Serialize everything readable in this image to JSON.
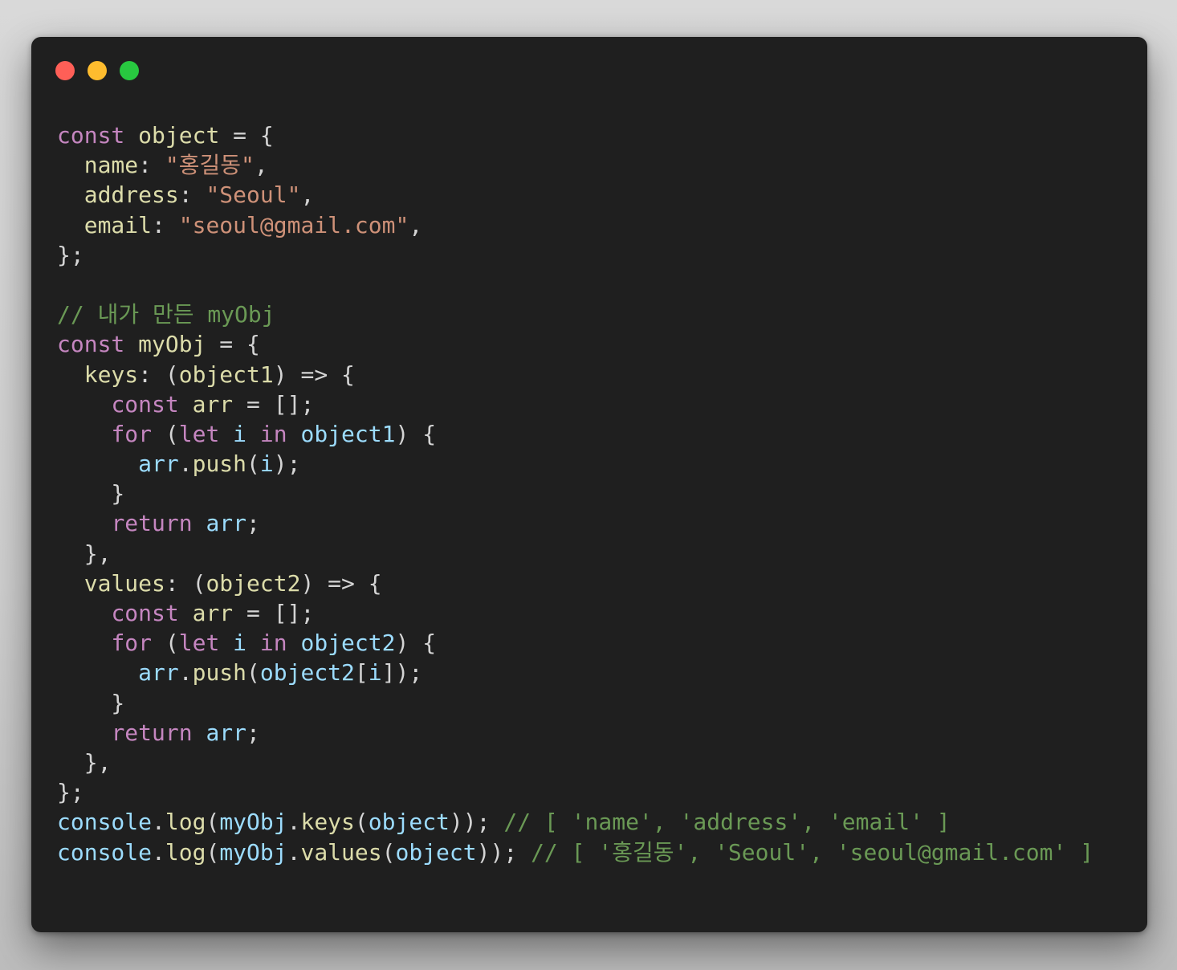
{
  "window": {
    "controls": {
      "close_color": "#ff5f57",
      "minimize_color": "#febc2e",
      "maximize_color": "#28c840"
    }
  },
  "code": {
    "language": "javascript",
    "lines": [
      [
        [
          "kw",
          "const "
        ],
        [
          "var",
          "object"
        ],
        [
          "pun",
          " = {"
        ]
      ],
      [
        [
          "pun",
          "  "
        ],
        [
          "var",
          "name"
        ],
        [
          "pun",
          ": "
        ],
        [
          "str",
          "\"홍길동\""
        ],
        [
          "pun",
          ","
        ]
      ],
      [
        [
          "pun",
          "  "
        ],
        [
          "var",
          "address"
        ],
        [
          "pun",
          ": "
        ],
        [
          "str",
          "\"Seoul\""
        ],
        [
          "pun",
          ","
        ]
      ],
      [
        [
          "pun",
          "  "
        ],
        [
          "var",
          "email"
        ],
        [
          "pun",
          ": "
        ],
        [
          "str",
          "\"seoul@gmail.com\""
        ],
        [
          "pun",
          ","
        ]
      ],
      [
        [
          "pun",
          "};"
        ]
      ],
      [],
      [
        [
          "cmt",
          "// 내가 만든 myObj"
        ]
      ],
      [
        [
          "kw",
          "const "
        ],
        [
          "var",
          "myObj"
        ],
        [
          "pun",
          " = {"
        ]
      ],
      [
        [
          "pun",
          "  "
        ],
        [
          "var",
          "keys"
        ],
        [
          "pun",
          ": ("
        ],
        [
          "var",
          "object1"
        ],
        [
          "pun",
          ") => {"
        ]
      ],
      [
        [
          "pun",
          "    "
        ],
        [
          "kw",
          "const "
        ],
        [
          "var",
          "arr"
        ],
        [
          "pun",
          " = [];"
        ]
      ],
      [
        [
          "pun",
          "    "
        ],
        [
          "kw",
          "for "
        ],
        [
          "pun",
          "("
        ],
        [
          "kw",
          "let "
        ],
        [
          "id",
          "i "
        ],
        [
          "kw",
          "in "
        ],
        [
          "id",
          "object1"
        ],
        [
          "pun",
          ") {"
        ]
      ],
      [
        [
          "pun",
          "      "
        ],
        [
          "id",
          "arr"
        ],
        [
          "pun",
          "."
        ],
        [
          "fn",
          "push"
        ],
        [
          "pun",
          "("
        ],
        [
          "id",
          "i"
        ],
        [
          "pun",
          ");"
        ]
      ],
      [
        [
          "pun",
          "    }"
        ]
      ],
      [
        [
          "pun",
          "    "
        ],
        [
          "kw",
          "return "
        ],
        [
          "id",
          "arr"
        ],
        [
          "pun",
          ";"
        ]
      ],
      [
        [
          "pun",
          "  },"
        ]
      ],
      [
        [
          "pun",
          "  "
        ],
        [
          "var",
          "values"
        ],
        [
          "pun",
          ": ("
        ],
        [
          "var",
          "object2"
        ],
        [
          "pun",
          ") => {"
        ]
      ],
      [
        [
          "pun",
          "    "
        ],
        [
          "kw",
          "const "
        ],
        [
          "var",
          "arr"
        ],
        [
          "pun",
          " = [];"
        ]
      ],
      [
        [
          "pun",
          "    "
        ],
        [
          "kw",
          "for "
        ],
        [
          "pun",
          "("
        ],
        [
          "kw",
          "let "
        ],
        [
          "id",
          "i "
        ],
        [
          "kw",
          "in "
        ],
        [
          "id",
          "object2"
        ],
        [
          "pun",
          ") {"
        ]
      ],
      [
        [
          "pun",
          "      "
        ],
        [
          "id",
          "arr"
        ],
        [
          "pun",
          "."
        ],
        [
          "fn",
          "push"
        ],
        [
          "pun",
          "("
        ],
        [
          "id",
          "object2"
        ],
        [
          "pun",
          "["
        ],
        [
          "id",
          "i"
        ],
        [
          "pun",
          "]);"
        ]
      ],
      [
        [
          "pun",
          "    }"
        ]
      ],
      [
        [
          "pun",
          "    "
        ],
        [
          "kw",
          "return "
        ],
        [
          "id",
          "arr"
        ],
        [
          "pun",
          ";"
        ]
      ],
      [
        [
          "pun",
          "  },"
        ]
      ],
      [
        [
          "pun",
          "};"
        ]
      ],
      [
        [
          "id",
          "console"
        ],
        [
          "pun",
          "."
        ],
        [
          "fn",
          "log"
        ],
        [
          "pun",
          "("
        ],
        [
          "id",
          "myObj"
        ],
        [
          "pun",
          "."
        ],
        [
          "fn",
          "keys"
        ],
        [
          "pun",
          "("
        ],
        [
          "id",
          "object"
        ],
        [
          "pun",
          "));"
        ],
        [
          "cmt",
          " // [ 'name', 'address', 'email' ]"
        ]
      ],
      [
        [
          "id",
          "console"
        ],
        [
          "pun",
          "."
        ],
        [
          "fn",
          "log"
        ],
        [
          "pun",
          "("
        ],
        [
          "id",
          "myObj"
        ],
        [
          "pun",
          "."
        ],
        [
          "fn",
          "values"
        ],
        [
          "pun",
          "("
        ],
        [
          "id",
          "object"
        ],
        [
          "pun",
          "));"
        ],
        [
          "cmt",
          " // [ '홍길동', 'Seoul', 'seoul@gmail.com' ]"
        ]
      ]
    ]
  }
}
